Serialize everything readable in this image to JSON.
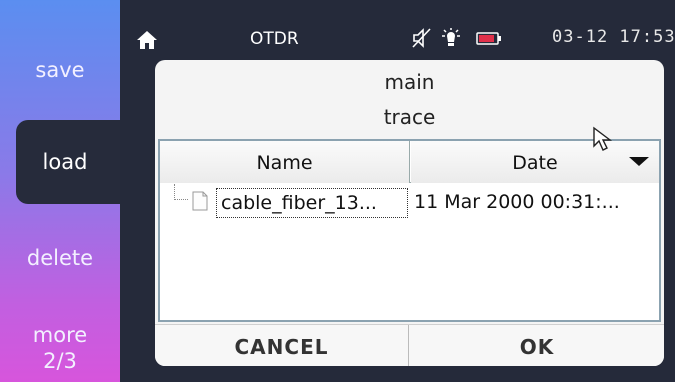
{
  "sidebar": {
    "save": "save",
    "load": "load",
    "delete": "delete",
    "more_label": "more",
    "more_page": "2/3"
  },
  "statusbar": {
    "title": "OTDR",
    "clock": "03-12 17:53",
    "icons": [
      "home-icon",
      "mute-icon",
      "brightness-icon",
      "battery-icon"
    ],
    "battery_color": "#e0304a"
  },
  "dialog": {
    "path_line1": "main",
    "path_line2": "trace",
    "columns": {
      "name": "Name",
      "date": "Date"
    },
    "files": [
      {
        "name": "cable_fiber_13...",
        "date": "11 Mar 2000 00:31:..."
      }
    ],
    "cancel_label": "CANCEL",
    "ok_label": "OK"
  }
}
